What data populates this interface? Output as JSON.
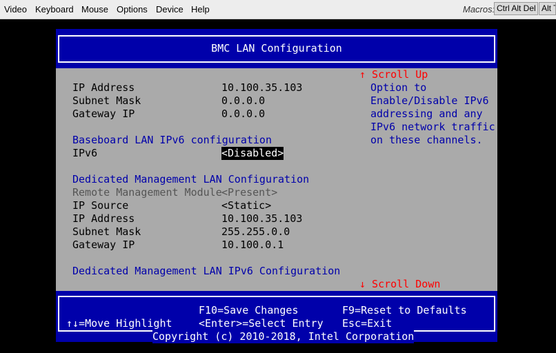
{
  "menubar": {
    "items": [
      "Video",
      "Keyboard",
      "Mouse",
      "Options",
      "Device",
      "Help"
    ],
    "macros_label": "Macros:",
    "macros": [
      "Ctrl Alt Del",
      "Alt T"
    ]
  },
  "screen": {
    "title": "BMC LAN Configuration",
    "fields": [
      {
        "label": "IP Address",
        "value": "10.100.35.103"
      },
      {
        "label": "Subnet Mask",
        "value": "0.0.0.0"
      },
      {
        "label": "Gateway IP",
        "value": "0.0.0.0"
      }
    ],
    "ipv6_section": "Baseboard LAN IPv6 configuration",
    "ipv6": {
      "label": "IPv6",
      "value": "<Disabled>"
    },
    "dedicated_section": "Dedicated Management LAN Configuration",
    "dedicated_fields": [
      {
        "label": "Remote Management Module",
        "value": "<Present>"
      },
      {
        "label": "IP Source",
        "value": "<Static>"
      },
      {
        "label": "IP Address",
        "value": "10.100.35.103"
      },
      {
        "label": "Subnet Mask",
        "value": "255.255.0.0"
      },
      {
        "label": "Gateway IP",
        "value": "10.100.0.1"
      }
    ],
    "dedicated_ipv6_section": "Dedicated Management LAN IPv6 Configuration",
    "help": {
      "scroll_up": "↑ Scroll Up",
      "lines": [
        "Option to",
        "Enable/Disable IPv6",
        "addressing and any",
        "IPv6 network traffic",
        "on these channels."
      ],
      "scroll_down": "↓ Scroll Down"
    },
    "footer": {
      "save": "F10=Save Changes",
      "reset": "F9=Reset to Defaults",
      "move": "↑↓=Move Highlight",
      "select": "<Enter>=Select Entry",
      "exit": "Esc=Exit"
    },
    "copyright": "Copyright (c) 2010-2018, Intel Corporation"
  },
  "colors": {
    "bios_blue": "#0000aa",
    "bios_gray": "#aaaaaa",
    "highlight_red": "#ff0000"
  }
}
